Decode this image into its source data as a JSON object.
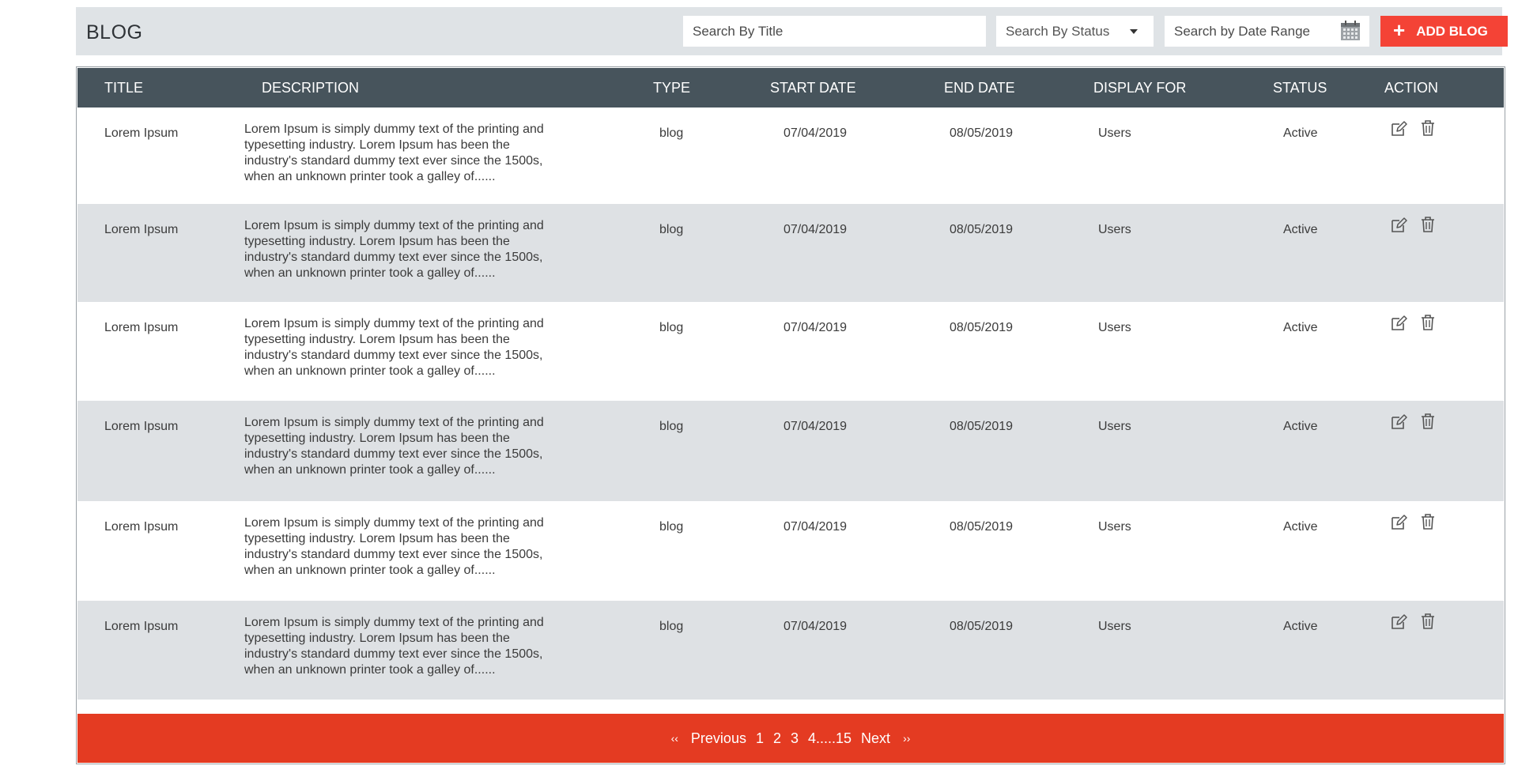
{
  "header": {
    "title": "BLOG",
    "search_title_placeholder": "Search By Title",
    "search_status_label": "Search By Status",
    "search_date_placeholder": "Search by Date Range",
    "add_button_label": "ADD BLOG",
    "accent": "#f44336"
  },
  "table": {
    "columns": [
      "TITLE",
      "DESCRIPTION",
      "TYPE",
      "START DATE",
      "END DATE",
      "DISPLAY FOR",
      "STATUS",
      "ACTION"
    ],
    "header_bg": "#47545c",
    "rows": [
      {
        "title": "Lorem Ipsum",
        "description": "Lorem Ipsum is simply dummy text of the printing and typesetting industry. Lorem Ipsum has been the industry's standard dummy text ever since the 1500s, when an unknown printer took a galley of......",
        "type": "blog",
        "start_date": "07/04/2019",
        "end_date": "08/05/2019",
        "display_for": "Users",
        "status": "Active"
      },
      {
        "title": "Lorem Ipsum",
        "description": "Lorem Ipsum is simply dummy text of the printing and typesetting industry. Lorem Ipsum has been the industry's standard dummy text ever since the 1500s, when an unknown printer took a galley of......",
        "type": "blog",
        "start_date": "07/04/2019",
        "end_date": "08/05/2019",
        "display_for": "Users",
        "status": "Active"
      },
      {
        "title": "Lorem Ipsum",
        "description": "Lorem Ipsum is simply dummy text of the printing and typesetting industry. Lorem Ipsum has been the industry's standard dummy text ever since the 1500s, when an unknown printer took a galley of......",
        "type": "blog",
        "start_date": "07/04/2019",
        "end_date": "08/05/2019",
        "display_for": "Users",
        "status": "Active"
      },
      {
        "title": "Lorem Ipsum",
        "description": "Lorem Ipsum is simply dummy text of the printing and typesetting industry. Lorem Ipsum has been the industry's standard dummy text ever since the 1500s, when an unknown printer took a galley of......",
        "type": "blog",
        "start_date": "07/04/2019",
        "end_date": "08/05/2019",
        "display_for": "Users",
        "status": "Active"
      },
      {
        "title": "Lorem Ipsum",
        "description": "Lorem Ipsum is simply dummy text of the printing and typesetting industry. Lorem Ipsum has been the industry's standard dummy text ever since the 1500s, when an unknown printer took a galley of......",
        "type": "blog",
        "start_date": "07/04/2019",
        "end_date": "08/05/2019",
        "display_for": "Users",
        "status": "Active"
      },
      {
        "title": "Lorem Ipsum",
        "description": "Lorem Ipsum is simply dummy text of the printing and typesetting industry. Lorem Ipsum has been the industry's standard dummy text ever since the 1500s, when an unknown printer took a galley of......",
        "type": "blog",
        "start_date": "07/04/2019",
        "end_date": "08/05/2019",
        "display_for": "Users",
        "status": "Active"
      }
    ],
    "row_actions": [
      "edit-icon",
      "trash-icon"
    ]
  },
  "pagination": {
    "first_symbol": "‹‹",
    "previous": "Previous",
    "pages": [
      "1",
      "2",
      "3",
      "4.....15"
    ],
    "next": "Next",
    "last_symbol": "››",
    "bg": "#e43b22"
  }
}
